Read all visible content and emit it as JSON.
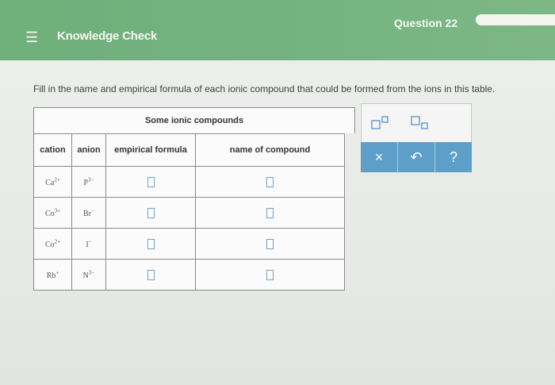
{
  "header": {
    "menu_icon": "hamburger-menu-icon",
    "title": "Knowledge Check",
    "question": "Question 22"
  },
  "instructions": "Fill in the name and empirical formula of each ionic compound that could be formed from the ions in this table.",
  "table": {
    "caption": "Some ionic compounds",
    "headers": [
      "cation",
      "anion",
      "empirical formula",
      "name of compound"
    ],
    "rows": [
      {
        "cation": "Ca",
        "cation_charge": "2+",
        "anion": "P",
        "anion_charge": "3−"
      },
      {
        "cation": "Co",
        "cation_charge": "3+",
        "anion": "Br",
        "anion_charge": "−"
      },
      {
        "cation": "Co",
        "cation_charge": "2+",
        "anion": "I",
        "anion_charge": "−"
      },
      {
        "cation": "Rb",
        "cation_charge": "+",
        "anion": "N",
        "anion_charge": "3−"
      }
    ]
  },
  "toolbar": {
    "superscript_button_icon": "superscript-template-icon",
    "subscript_button_icon": "subscript-template-icon",
    "clear_label": "×",
    "undo_label": "↶",
    "help_label": "?"
  },
  "colors": {
    "header_green": "#75b481",
    "action_blue": "#5d9fc9"
  }
}
